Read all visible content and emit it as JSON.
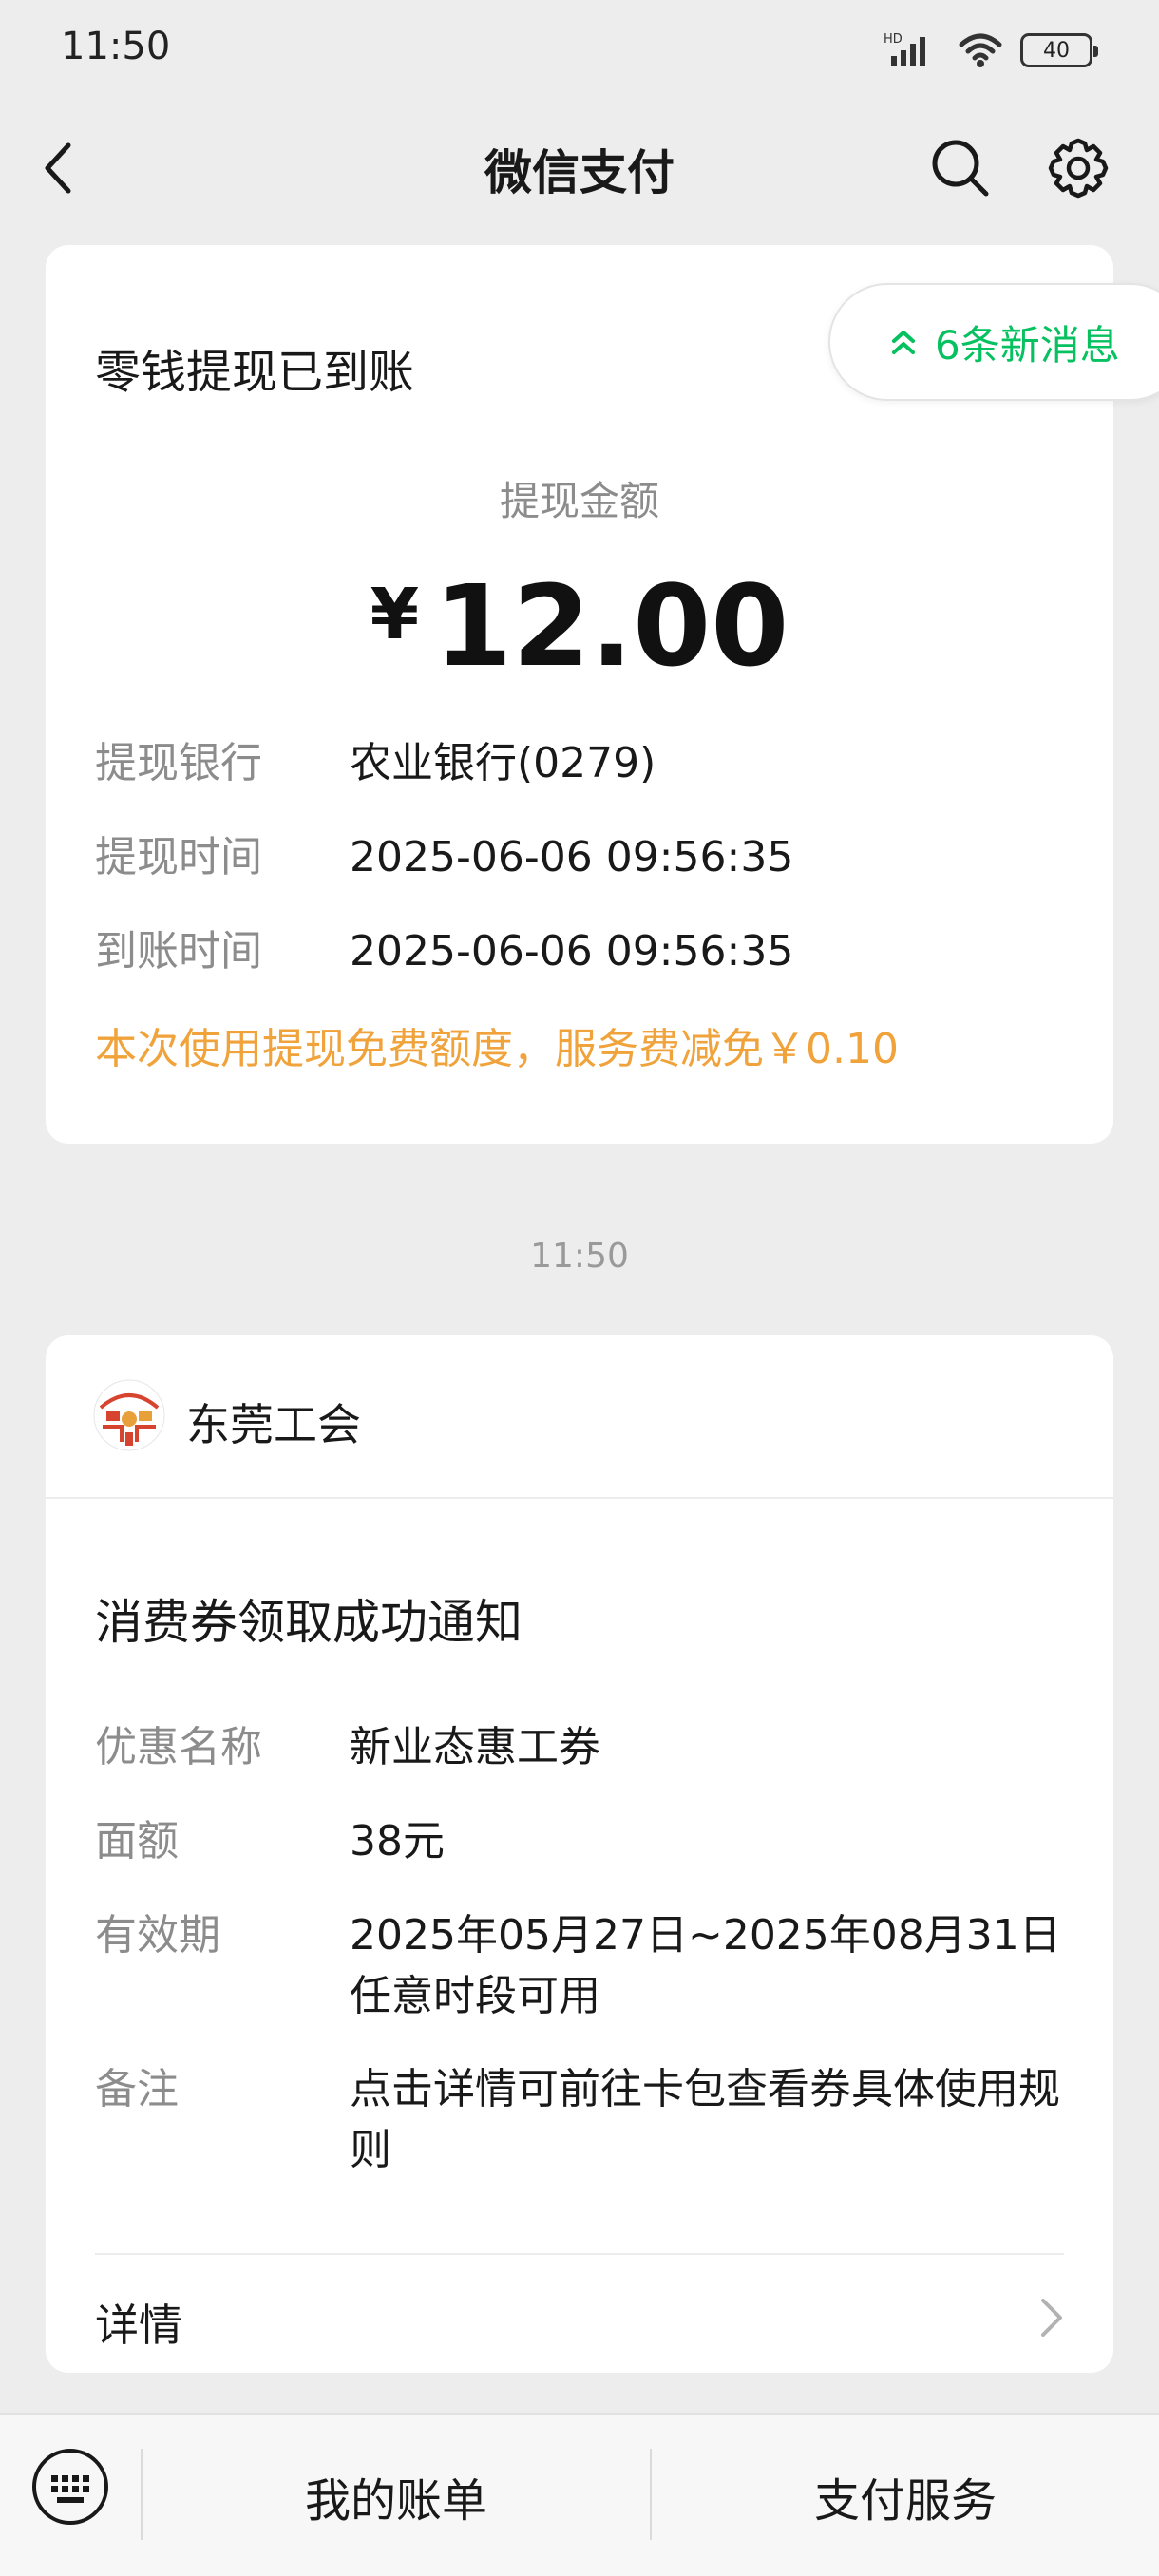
{
  "status_bar": {
    "time": "11:50",
    "network_label": "HD",
    "battery": "40",
    "icons": [
      "signal-icon",
      "wifi-icon",
      "battery-icon"
    ]
  },
  "nav": {
    "title": "微信支付",
    "back_icon": "back-arrow-icon",
    "search_icon": "search-icon",
    "settings_icon": "gear-icon"
  },
  "withdraw_card": {
    "title": "零钱提现已到账",
    "amount_label": "提现金额",
    "currency": "¥",
    "amount": "12.00",
    "rows": [
      {
        "label": "提现银行",
        "value": "农业银行(0279)"
      },
      {
        "label": "提现时间",
        "value": "2025-06-06 09:56:35"
      },
      {
        "label": "到账时间",
        "value": "2025-06-06 09:56:35"
      }
    ],
    "note": "本次使用提现免费额度，服务费减免￥0.10"
  },
  "new_messages": {
    "label": "6条新消息"
  },
  "timestamp": "11:50",
  "union_card": {
    "name": "东莞工会",
    "title": "消费券领取成功通知",
    "rows": [
      {
        "label": "优惠名称",
        "value": "新业态惠工券"
      },
      {
        "label": "面额",
        "value": "38元"
      },
      {
        "label": "有效期",
        "value": "2025年05月27日~2025年08月31日任意时段可用"
      },
      {
        "label": "备注",
        "value": "点击详情可前往卡包查看券具体使用规则"
      }
    ],
    "detail_label": "详情"
  },
  "bottom_bar": {
    "bill_label": "我的账单",
    "service_label": "支付服务",
    "keyboard_icon": "keyboard-icon"
  },
  "colors": {
    "background": "#ededed",
    "card": "#ffffff",
    "accent_green": "#07c160",
    "note_orange": "#f0a23b",
    "secondary_text": "#8c8c8c"
  }
}
